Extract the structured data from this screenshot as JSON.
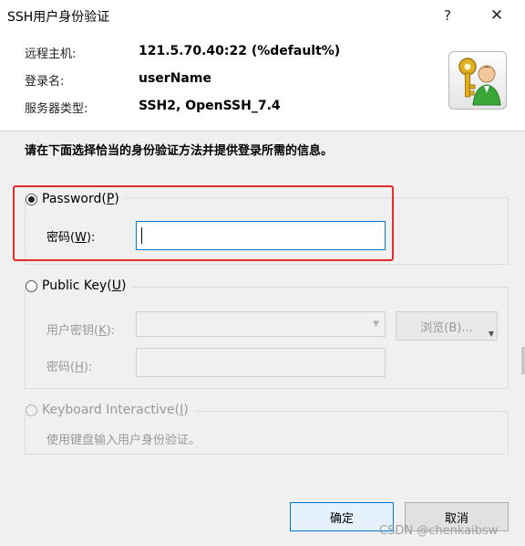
{
  "window": {
    "title": "SSH用户身份验证",
    "help_glyph": "?",
    "close_glyph": "✕"
  },
  "info": {
    "host_label": "远程主机:",
    "host_value": "121.5.70.40:22 (%default%)",
    "login_label": "登录名:",
    "login_value": "userName",
    "server_type_label": "服务器类型:",
    "server_type_value": "SSH2, OpenSSH_7.4"
  },
  "instruction": "请在下面选择恰当的身份验证方法并提供登录所需的信息。",
  "password_group": {
    "label_prefix": "Password(",
    "label_key": "P",
    "label_suffix": ")",
    "selected": true,
    "field_label_prefix": "密码(",
    "field_key": "W",
    "field_label_suffix": "):",
    "value": ""
  },
  "publickey_group": {
    "label_prefix": "Public Key(",
    "label_key": "U",
    "label_suffix": ")",
    "selected": false,
    "key_label_prefix": "用户密钥(",
    "key_key": "K",
    "key_label_suffix": "):",
    "key_value": "",
    "browse_label": "浏览(B)...",
    "passphrase_label_prefix": "密码(",
    "passphrase_key": "H",
    "passphrase_label_suffix": "):"
  },
  "keyboard_group": {
    "label_prefix": "Keyboard Interactive(",
    "label_key": "I",
    "label_suffix": ")",
    "description": "使用键盘输入用户身份验证。"
  },
  "buttons": {
    "ok": "确定",
    "cancel": "取消"
  },
  "watermark": "CSDN @chenkaibsw",
  "colors": {
    "highlight": "#e62b2b",
    "focus": "#0078d7",
    "icon_key": "#e0b020",
    "icon_person_shirt": "#3aa63a"
  },
  "icons": {
    "user_key": "user-key-icon"
  }
}
